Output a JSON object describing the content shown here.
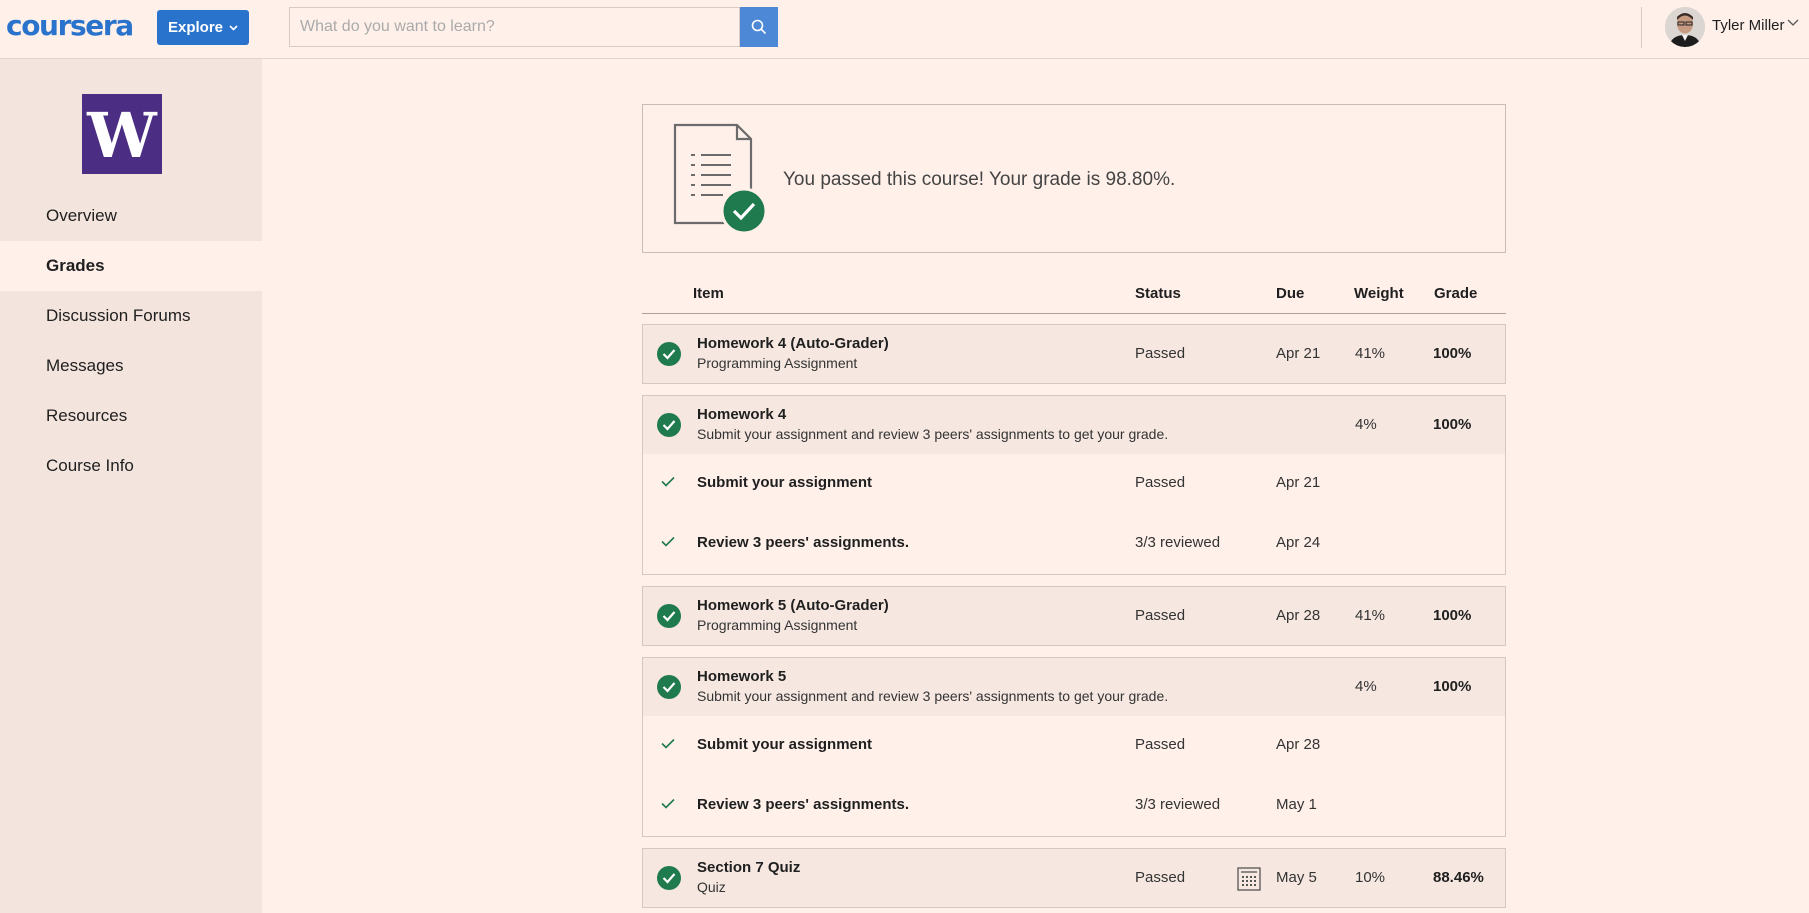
{
  "header": {
    "logo": "coursera",
    "explore_label": "Explore",
    "search_placeholder": "What do you want to learn?",
    "search_value": "",
    "user_name": "Tyler Miller",
    "icons": [
      "search-icon",
      "chevron-down-icon",
      "avatar"
    ],
    "accent_color": "#2a73cc"
  },
  "sidebar": {
    "logo_letter": "W",
    "logo_color": "#4b2e83",
    "items": [
      {
        "label": "Overview",
        "active": false
      },
      {
        "label": "Grades",
        "active": true
      },
      {
        "label": "Discussion Forums",
        "active": false
      },
      {
        "label": "Messages",
        "active": false
      },
      {
        "label": "Resources",
        "active": false
      },
      {
        "label": "Course Info",
        "active": false
      }
    ]
  },
  "summary": {
    "text": "You passed this course! Your grade is 98.80%."
  },
  "table": {
    "headers": {
      "item": "Item",
      "status": "Status",
      "due": "Due",
      "weight": "Weight",
      "grade": "Grade"
    },
    "rows": [
      {
        "title": "Homework 4 (Auto-Grader)",
        "subtitle": "Programming Assignment",
        "status": "Passed",
        "due": "Apr 21",
        "weight": "41%",
        "grade": "100%"
      },
      {
        "title": "Homework 4",
        "subtitle": "Submit your assignment and review 3 peers' assignments to get your grade.",
        "status": "",
        "due": "",
        "weight": "4%",
        "grade": "100%",
        "subitems": [
          {
            "title": "Submit your assignment",
            "status": "Passed",
            "due": "Apr 21"
          },
          {
            "title": "Review 3 peers' assignments.",
            "status": "3/3 reviewed",
            "due": "Apr 24"
          }
        ]
      },
      {
        "title": "Homework 5 (Auto-Grader)",
        "subtitle": "Programming Assignment",
        "status": "Passed",
        "due": "Apr 28",
        "weight": "41%",
        "grade": "100%"
      },
      {
        "title": "Homework 5",
        "subtitle": "Submit your assignment and review 3 peers' assignments to get your grade.",
        "status": "",
        "due": "",
        "weight": "4%",
        "grade": "100%",
        "subitems": [
          {
            "title": "Submit your assignment",
            "status": "Passed",
            "due": "Apr 28"
          },
          {
            "title": "Review 3 peers' assignments.",
            "status": "3/3 reviewed",
            "due": "May 1"
          }
        ]
      },
      {
        "title": "Section 7 Quiz",
        "subtitle": "Quiz",
        "status": "Passed",
        "due": "May 5",
        "weight": "10%",
        "grade": "88.46%"
      }
    ],
    "status_color": "#1f7a4d"
  }
}
